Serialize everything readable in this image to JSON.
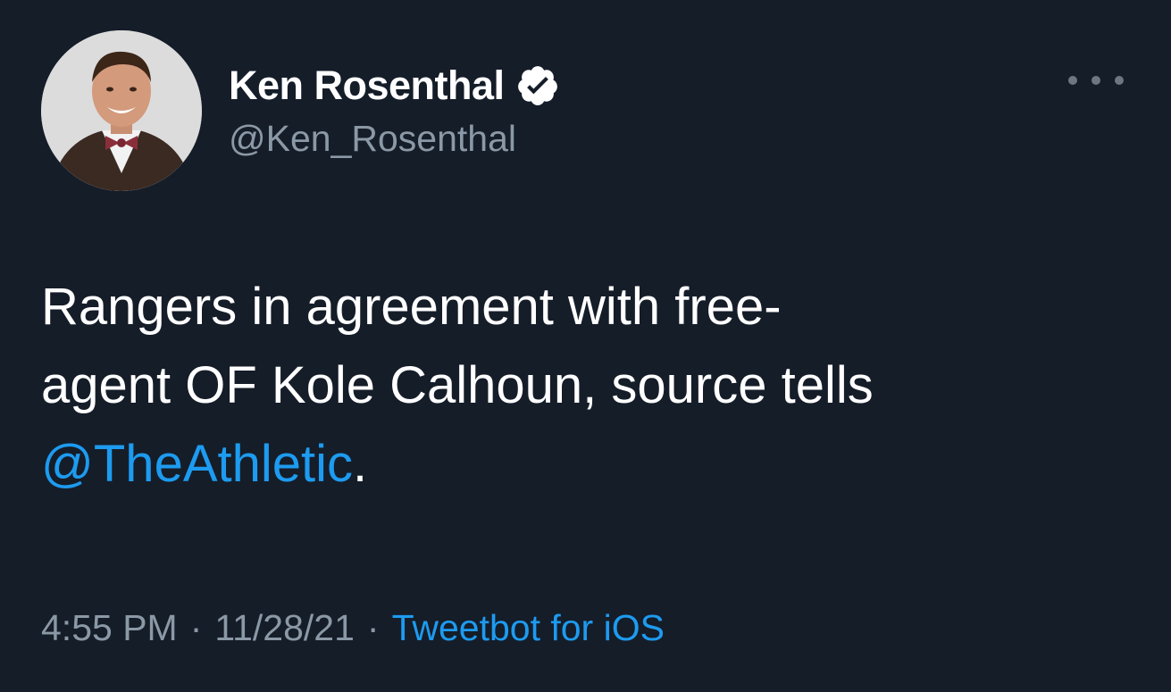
{
  "author": {
    "display_name": "Ken Rosenthal",
    "handle": "@Ken_Rosenthal",
    "verified": true,
    "avatar_icon": "profile-photo"
  },
  "menu": {
    "icon": "more-horizontal-icon"
  },
  "tweet": {
    "line1": "Rangers in agreement with free-",
    "line2": "agent OF Kole Calhoun, source tells",
    "mention": "@TheAthletic",
    "trailing": "."
  },
  "meta": {
    "time": "4:55 PM",
    "date": "11/28/21",
    "separator": "·",
    "source": "Tweetbot for iOS"
  },
  "colors": {
    "background": "#151d29",
    "link": "#1d9bf0",
    "secondary_text": "#8b98a5",
    "primary_text": "#ffffff"
  }
}
